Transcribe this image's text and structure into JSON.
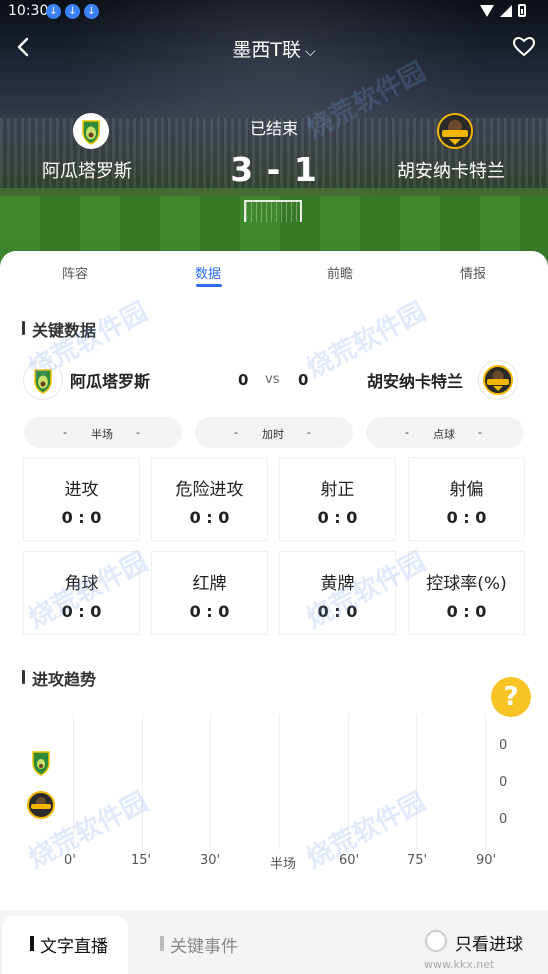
{
  "status_bar": {
    "time": "10:30",
    "download_icons": [
      "download-icon",
      "download-icon",
      "download-icon"
    ]
  },
  "nav": {
    "title": "墨西T联",
    "title_chevron": "⌄",
    "back_icon": "chevron-left-icon",
    "favorite_icon": "heart-icon"
  },
  "match": {
    "status": "已结束",
    "score": "3 - 1",
    "home": {
      "name": "阿瓜塔罗斯"
    },
    "away": {
      "name": "胡安纳卡特兰"
    }
  },
  "tabs": [
    {
      "label": "阵容"
    },
    {
      "label": "数据"
    },
    {
      "label": "前瞻"
    },
    {
      "label": "情报"
    }
  ],
  "key_data": {
    "title": "关键数据",
    "home_name": "阿瓜塔罗斯",
    "away_name": "胡安纳卡特兰",
    "home_score": "0",
    "vs": "vs",
    "away_score": "0",
    "pills": [
      {
        "left": "-",
        "label": "半场",
        "right": "-"
      },
      {
        "left": "-",
        "label": "加时",
        "right": "-"
      },
      {
        "left": "-",
        "label": "点球",
        "right": "-"
      }
    ],
    "stats": [
      {
        "label": "进攻",
        "value": "0 : 0"
      },
      {
        "label": "危险进攻",
        "value": "0 : 0"
      },
      {
        "label": "射正",
        "value": "0 : 0"
      },
      {
        "label": "射偏",
        "value": "0 : 0"
      },
      {
        "label": "角球",
        "value": "0 : 0"
      },
      {
        "label": "红牌",
        "value": "0 : 0"
      },
      {
        "label": "黄牌",
        "value": "0 : 0"
      },
      {
        "label": "控球率(%)",
        "value": "0 : 0"
      }
    ]
  },
  "attack_trend": {
    "title": "进攻趋势",
    "help_icon": "question-icon",
    "x_ticks": [
      "0'",
      "15'",
      "30'",
      "半场",
      "60'",
      "75'",
      "90'"
    ],
    "y_values": [
      "0",
      "0",
      "0"
    ]
  },
  "bottom_tabs": {
    "live_text": "文字直播",
    "key_events": "关键事件",
    "goals_only": "只看进球"
  },
  "watermark": {
    "text": "烧荒软件园",
    "site": "www.kkx.net"
  },
  "colors": {
    "accent": "#2b6ef6",
    "help": "#f7c325",
    "pitch": "#3d7a2b"
  }
}
